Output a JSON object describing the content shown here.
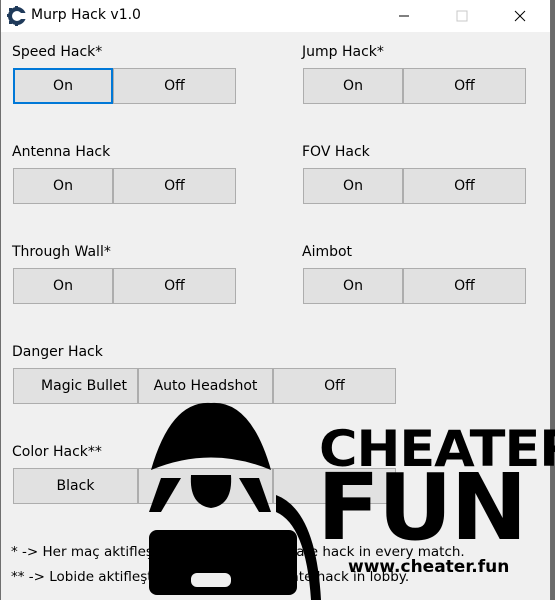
{
  "window": {
    "title": "Murp Hack v1.0",
    "controls": {
      "minimize": "—",
      "maximize": "☐",
      "close": "✕"
    }
  },
  "sections": {
    "speed": {
      "label": "Speed Hack*",
      "on": "On",
      "off": "Off"
    },
    "jump": {
      "label": "Jump Hack*",
      "on": "On",
      "off": "Off"
    },
    "antenna": {
      "label": "Antenna Hack",
      "on": "On",
      "off": "Off"
    },
    "fov": {
      "label": "FOV Hack",
      "on": "On",
      "off": "Off"
    },
    "wall": {
      "label": "Through Wall*",
      "on": "On",
      "off": "Off"
    },
    "aimbot": {
      "label": "Aimbot",
      "on": "On",
      "off": "Off"
    },
    "danger": {
      "label": "Danger Hack",
      "opt1": "Magic Bullet",
      "opt2": "Auto Headshot",
      "off": "Off"
    },
    "color": {
      "label": "Color Hack**",
      "opt1": "Black",
      "opt2": "",
      "opt3": ""
    }
  },
  "notes": {
    "line1": "* -> Her maç aktifleştirin. - You must activate hack in every match.",
    "line2": "** -> Lobide aktifleştirin. - You must activate hack in lobby."
  },
  "watermark": {
    "line1": "CHEATER",
    "line2": "FUN",
    "url": "www.cheater.fun"
  }
}
